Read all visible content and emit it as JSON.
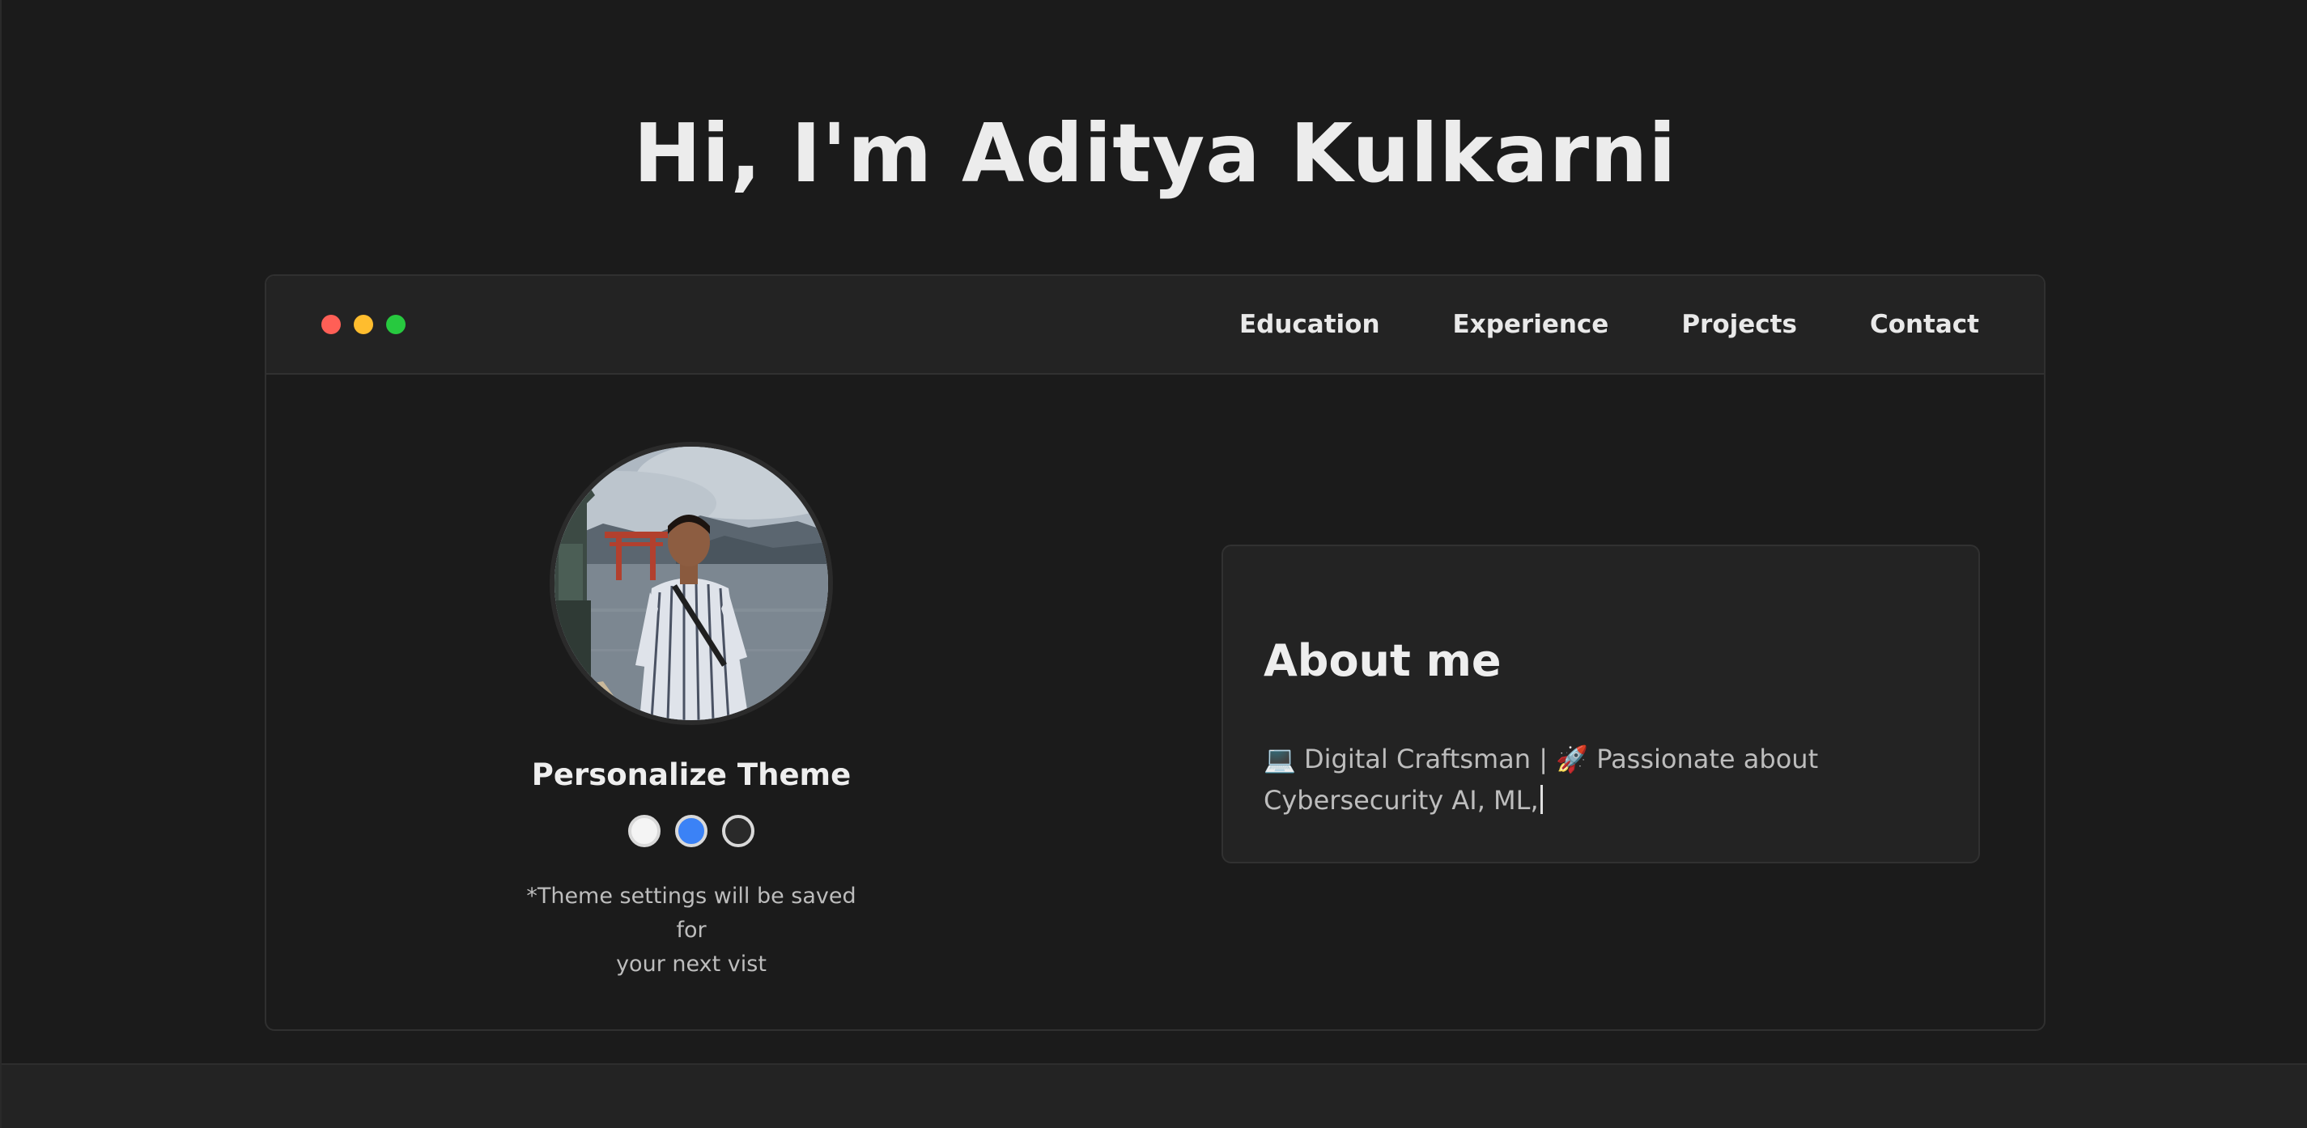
{
  "hero": {
    "title": "Hi, I'm Aditya Kulkarni"
  },
  "window": {
    "controls": [
      {
        "name": "close",
        "color": "#ff5f56"
      },
      {
        "name": "minimize",
        "color": "#ffbd2e"
      },
      {
        "name": "maximize",
        "color": "#27c93f"
      }
    ],
    "nav": {
      "education": "Education",
      "experience": "Experience",
      "projects": "Projects",
      "contact": "Contact"
    }
  },
  "profile": {
    "photo": "profile-photo",
    "theme_heading": "Personalize Theme",
    "swatches": [
      {
        "name": "light",
        "color": "#f4f4f4"
      },
      {
        "name": "blue",
        "color": "#3b82f6"
      },
      {
        "name": "dark",
        "color": "#2a2a2a"
      }
    ],
    "theme_note_line1": "*Theme settings will be saved for",
    "theme_note_line2": "your next vist"
  },
  "about": {
    "title": "About me",
    "line1_icon1": "💻",
    "line1_part1": " Digital Craftsman | ",
    "line1_icon2": "🚀",
    "line1_part2": " Passionate about",
    "line2": "Cybersecurity AI, ML,"
  },
  "colors": {
    "background": "#1b1b1b",
    "panel": "#232323",
    "border": "#313131",
    "text": "#e6e6e6",
    "muted": "#bdbdbd"
  }
}
